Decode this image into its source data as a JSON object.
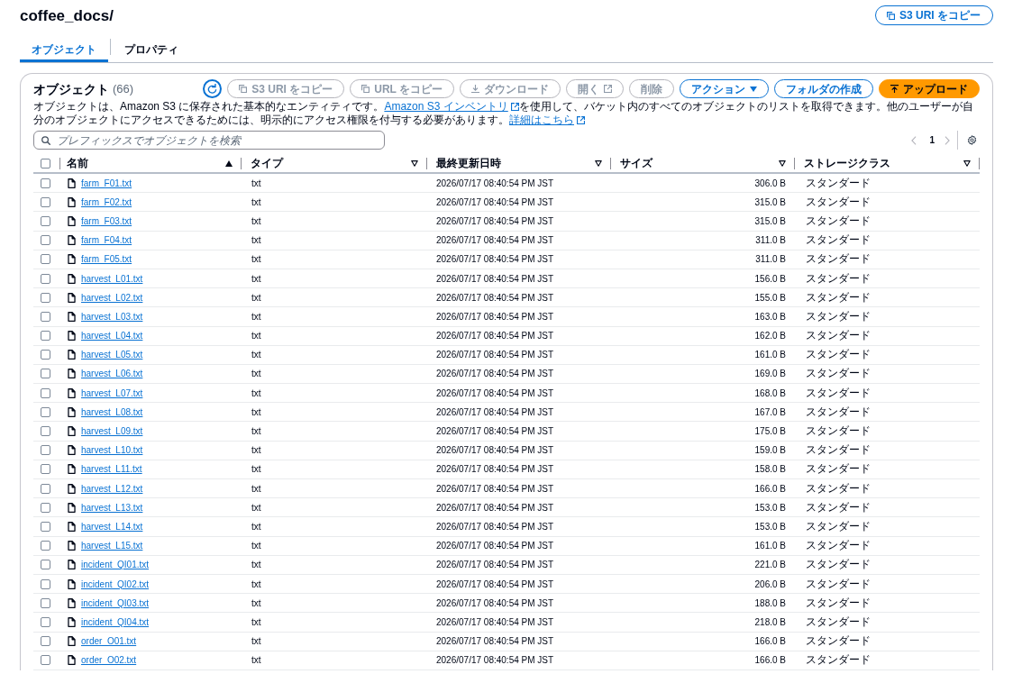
{
  "header": {
    "title": "coffee_docs/",
    "button": {
      "kind": "copy",
      "label": "S3 URI をコピー",
      "disabled": false
    }
  },
  "tabs": [
    {
      "label": "オブジェクト",
      "selected": true
    },
    {
      "label": "プロパティ",
      "selected": false
    }
  ],
  "objects": {
    "title": "オブジェクト",
    "count": "(66)",
    "buttons": [
      {
        "kind": "refresh",
        "disabled": false
      },
      {
        "kind": "copy",
        "label": "S3 URI をコピー",
        "disabled": true
      },
      {
        "kind": "copy",
        "label": "URL をコピー",
        "disabled": true
      },
      {
        "kind": "download",
        "label": "ダウンロード",
        "disabled": true
      },
      {
        "kind": "open",
        "label": "開く",
        "disabled": true
      },
      {
        "kind": "delete",
        "label": "削除",
        "disabled": true
      },
      {
        "kind": "dropdown",
        "label": "アクション",
        "disabled": false
      },
      {
        "kind": "create",
        "label": "フォルダの作成",
        "disabled": false
      },
      {
        "kind": "upload",
        "label": "アップロード",
        "disabled": false
      }
    ],
    "description": [
      {
        "kind": "text",
        "text": "オブジェクトは、Amazon S3 に保存された基本的なエンティティです。"
      },
      {
        "kind": "link",
        "text": "Amazon S3 インベントリ",
        "external": true
      },
      {
        "kind": "text",
        "text": "を使用して、バケット内のすべてのオブジェクトのリストを取得できます。他のユーザーが自分のオブジェクトにアクセスできるためには、明示的にアクセス権限を付与する必要があります。"
      },
      {
        "kind": "link",
        "text": "詳細はこちら",
        "external": true
      }
    ],
    "search": {
      "placeholder": "プレフィックスでオブジェクトを検索"
    },
    "pagination": {
      "page": "1",
      "previous_disabled": true,
      "next_disabled": true
    },
    "table": {
      "select_all": {
        "checked": false
      },
      "columns": [
        {
          "label": "名前",
          "sorted": true
        },
        {
          "label": "タイプ",
          "sorted": false
        },
        {
          "label": "最終更新日時",
          "sorted": false
        },
        {
          "label": "サイズ",
          "sorted": false
        },
        {
          "label": "ストレージクラス",
          "sorted": false
        }
      ],
      "rows": [
        {
          "name": "farm_F01.txt",
          "type": "txt",
          "last_modified": "2026/07/17 08:40:54 PM JST",
          "size": "306.0 B",
          "storage_class": "スタンダード",
          "selected": false
        },
        {
          "name": "farm_F02.txt",
          "type": "txt",
          "last_modified": "2026/07/17 08:40:54 PM JST",
          "size": "315.0 B",
          "storage_class": "スタンダード",
          "selected": false
        },
        {
          "name": "farm_F03.txt",
          "type": "txt",
          "last_modified": "2026/07/17 08:40:54 PM JST",
          "size": "315.0 B",
          "storage_class": "スタンダード",
          "selected": false
        },
        {
          "name": "farm_F04.txt",
          "type": "txt",
          "last_modified": "2026/07/17 08:40:54 PM JST",
          "size": "311.0 B",
          "storage_class": "スタンダード",
          "selected": false
        },
        {
          "name": "farm_F05.txt",
          "type": "txt",
          "last_modified": "2026/07/17 08:40:54 PM JST",
          "size": "311.0 B",
          "storage_class": "スタンダード",
          "selected": false
        },
        {
          "name": "harvest_L01.txt",
          "type": "txt",
          "last_modified": "2026/07/17 08:40:54 PM JST",
          "size": "156.0 B",
          "storage_class": "スタンダード",
          "selected": false
        },
        {
          "name": "harvest_L02.txt",
          "type": "txt",
          "last_modified": "2026/07/17 08:40:54 PM JST",
          "size": "155.0 B",
          "storage_class": "スタンダード",
          "selected": false
        },
        {
          "name": "harvest_L03.txt",
          "type": "txt",
          "last_modified": "2026/07/17 08:40:54 PM JST",
          "size": "163.0 B",
          "storage_class": "スタンダード",
          "selected": false
        },
        {
          "name": "harvest_L04.txt",
          "type": "txt",
          "last_modified": "2026/07/17 08:40:54 PM JST",
          "size": "162.0 B",
          "storage_class": "スタンダード",
          "selected": false
        },
        {
          "name": "harvest_L05.txt",
          "type": "txt",
          "last_modified": "2026/07/17 08:40:54 PM JST",
          "size": "161.0 B",
          "storage_class": "スタンダード",
          "selected": false
        },
        {
          "name": "harvest_L06.txt",
          "type": "txt",
          "last_modified": "2026/07/17 08:40:54 PM JST",
          "size": "169.0 B",
          "storage_class": "スタンダード",
          "selected": false
        },
        {
          "name": "harvest_L07.txt",
          "type": "txt",
          "last_modified": "2026/07/17 08:40:54 PM JST",
          "size": "168.0 B",
          "storage_class": "スタンダード",
          "selected": false
        },
        {
          "name": "harvest_L08.txt",
          "type": "txt",
          "last_modified": "2026/07/17 08:40:54 PM JST",
          "size": "167.0 B",
          "storage_class": "スタンダード",
          "selected": false
        },
        {
          "name": "harvest_L09.txt",
          "type": "txt",
          "last_modified": "2026/07/17 08:40:54 PM JST",
          "size": "175.0 B",
          "storage_class": "スタンダード",
          "selected": false
        },
        {
          "name": "harvest_L10.txt",
          "type": "txt",
          "last_modified": "2026/07/17 08:40:54 PM JST",
          "size": "159.0 B",
          "storage_class": "スタンダード",
          "selected": false
        },
        {
          "name": "harvest_L11.txt",
          "type": "txt",
          "last_modified": "2026/07/17 08:40:54 PM JST",
          "size": "158.0 B",
          "storage_class": "スタンダード",
          "selected": false
        },
        {
          "name": "harvest_L12.txt",
          "type": "txt",
          "last_modified": "2026/07/17 08:40:54 PM JST",
          "size": "166.0 B",
          "storage_class": "スタンダード",
          "selected": false
        },
        {
          "name": "harvest_L13.txt",
          "type": "txt",
          "last_modified": "2026/07/17 08:40:54 PM JST",
          "size": "153.0 B",
          "storage_class": "スタンダード",
          "selected": false
        },
        {
          "name": "harvest_L14.txt",
          "type": "txt",
          "last_modified": "2026/07/17 08:40:54 PM JST",
          "size": "153.0 B",
          "storage_class": "スタンダード",
          "selected": false
        },
        {
          "name": "harvest_L15.txt",
          "type": "txt",
          "last_modified": "2026/07/17 08:40:54 PM JST",
          "size": "161.0 B",
          "storage_class": "スタンダード",
          "selected": false
        },
        {
          "name": "incident_QI01.txt",
          "type": "txt",
          "last_modified": "2026/07/17 08:40:54 PM JST",
          "size": "221.0 B",
          "storage_class": "スタンダード",
          "selected": false
        },
        {
          "name": "incident_QI02.txt",
          "type": "txt",
          "last_modified": "2026/07/17 08:40:54 PM JST",
          "size": "206.0 B",
          "storage_class": "スタンダード",
          "selected": false
        },
        {
          "name": "incident_QI03.txt",
          "type": "txt",
          "last_modified": "2026/07/17 08:40:54 PM JST",
          "size": "188.0 B",
          "storage_class": "スタンダード",
          "selected": false
        },
        {
          "name": "incident_QI04.txt",
          "type": "txt",
          "last_modified": "2026/07/17 08:40:54 PM JST",
          "size": "218.0 B",
          "storage_class": "スタンダード",
          "selected": false
        },
        {
          "name": "order_O01.txt",
          "type": "txt",
          "last_modified": "2026/07/17 08:40:54 PM JST",
          "size": "166.0 B",
          "storage_class": "スタンダード",
          "selected": false
        },
        {
          "name": "order_O02.txt",
          "type": "txt",
          "last_modified": "2026/07/17 08:40:54 PM JST",
          "size": "166.0 B",
          "storage_class": "スタンダード",
          "selected": false
        }
      ]
    }
  }
}
